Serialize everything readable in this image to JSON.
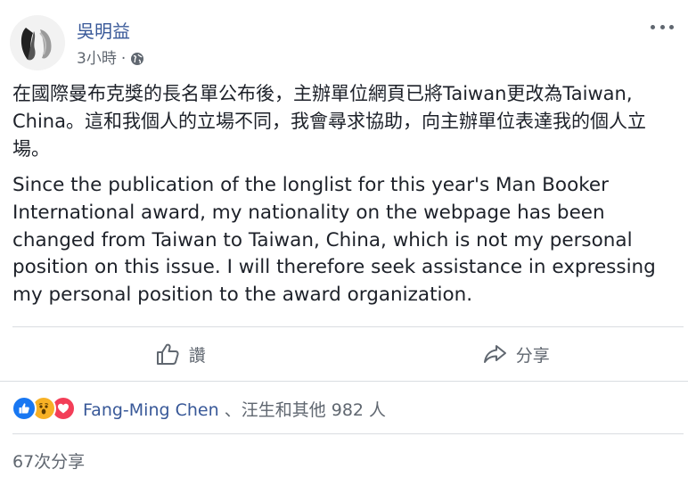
{
  "post": {
    "author": "吳明益",
    "time": "3小時",
    "time_separator": "·",
    "text_zh": "在國際曼布克獎的長名單公布後，主辦單位網頁已將Taiwan更改為Taiwan, China。這和我個人的立場不同，我會尋求協助，向主辦單位表達我的個人立場。",
    "text_en": "Since the publication of the longlist for this year's Man Booker International award, my nationality on the webpage has been changed from Taiwan to Taiwan, China, which is not my personal position on this issue. I will therefore seek assistance in expressing my personal position to the award organization."
  },
  "actions": {
    "like_label": "讚",
    "share_label": "分享"
  },
  "reactions": {
    "icons": [
      "like-icon",
      "wow-icon",
      "love-icon"
    ],
    "name": "Fang-Ming Chen",
    "others": "、汪生和其他 982 人"
  },
  "shares": {
    "label": "67次分享"
  },
  "colors": {
    "link": "#385898",
    "secondary_text": "#606770",
    "like_blue": "#1877f2",
    "wow_yellow": "#f7b125",
    "love_red": "#f33e58",
    "divider": "#dadde1"
  }
}
